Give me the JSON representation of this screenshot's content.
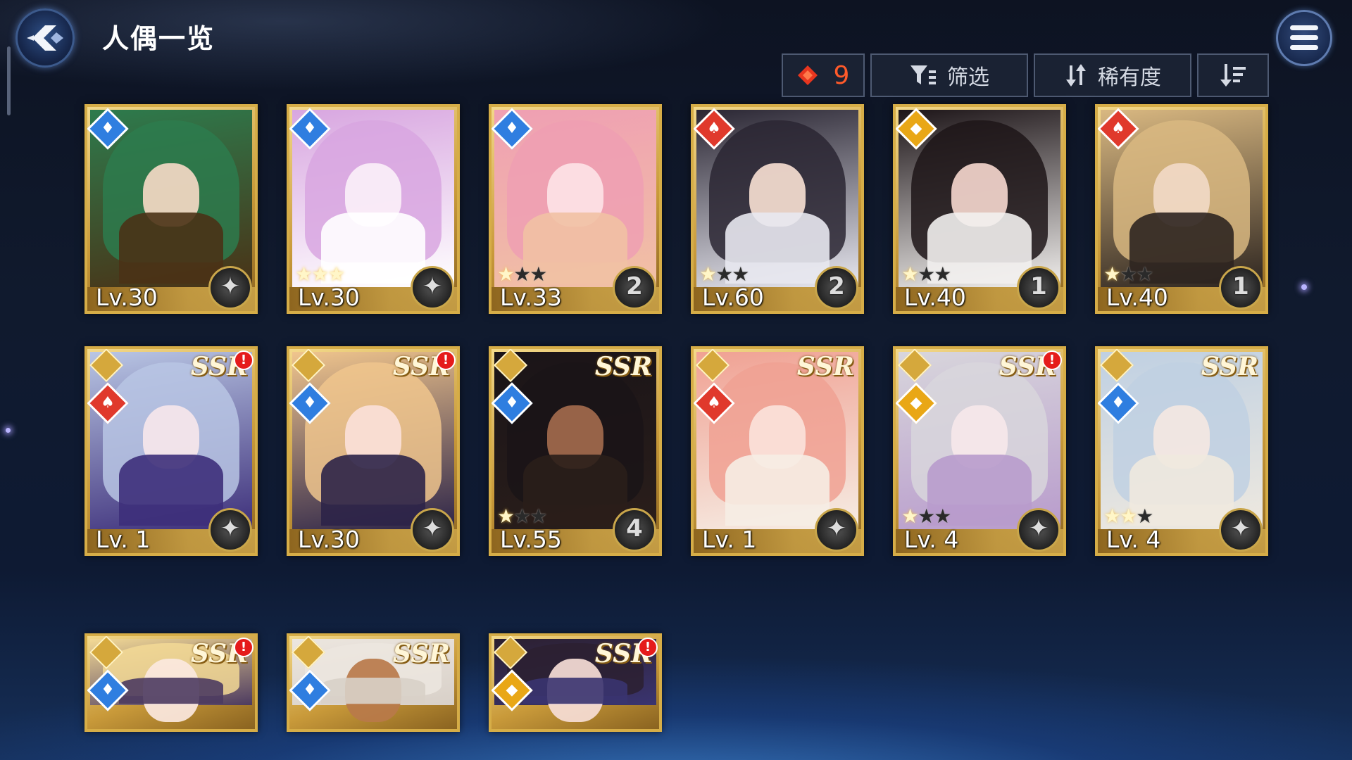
{
  "header": {
    "title": "人偶一览",
    "back_icon": "back-arrow-icon",
    "menu_icon": "hamburger-menu-icon"
  },
  "toolbar": {
    "count": "9",
    "count_icon": "diamond-icon",
    "filter_label": "筛选",
    "filter_icon": "filter-icon",
    "sort_label": "稀有度",
    "sort_icon": "sort-arrows-icon",
    "order_icon": "sort-order-icon"
  },
  "colors": {
    "gold_frame": "#d6ad47",
    "count_red": "#ff5a2a",
    "water": "#2f7ee0",
    "fire": "#e0392c",
    "light": "#e9a716"
  },
  "cards": [
    {
      "level": "Lv.30",
      "element": "water",
      "badge": "",
      "ssr": "",
      "alert": false,
      "stars": 0,
      "max_stars": 0,
      "palette": [
        "#2d7b4d",
        "#f4d9c4",
        "#4a3216"
      ]
    },
    {
      "level": "Lv.30",
      "element": "water",
      "badge": "",
      "ssr": "",
      "alert": false,
      "stars": 3,
      "max_stars": 3,
      "palette": [
        "#d8a6e0",
        "#fbeff8",
        "#ffffff"
      ]
    },
    {
      "level": "Lv.33",
      "element": "water",
      "badge": "2",
      "ssr": "",
      "alert": false,
      "stars": 1,
      "max_stars": 3,
      "palette": [
        "#ef9fb3",
        "#fde2e6",
        "#f1c1a4"
      ]
    },
    {
      "level": "Lv.60",
      "element": "fire",
      "badge": "2",
      "ssr": "",
      "alert": false,
      "stars": 1,
      "max_stars": 3,
      "palette": [
        "#2a2633",
        "#f5ddd0",
        "#e8e8f0"
      ]
    },
    {
      "level": "Lv.40",
      "element": "light",
      "badge": "1",
      "ssr": "",
      "alert": false,
      "stars": 1,
      "max_stars": 3,
      "palette": [
        "#1d1518",
        "#f3d5cc",
        "#f2f0ee"
      ]
    },
    {
      "level": "Lv.40",
      "element": "fire",
      "badge": "1",
      "ssr": "",
      "alert": false,
      "stars": 1,
      "max_stars": 3,
      "palette": [
        "#d9b881",
        "#f1d9c6",
        "#2d2520"
      ]
    },
    {
      "level": "Lv. 1",
      "element": "fire",
      "badge": "",
      "ssr": "SSR",
      "alert": true,
      "stars": 0,
      "max_stars": 0,
      "palette": [
        "#b9c6e4",
        "#f6e6ea",
        "#3d2f7a"
      ]
    },
    {
      "level": "Lv.30",
      "element": "water",
      "badge": "",
      "ssr": "SSR",
      "alert": true,
      "stars": 0,
      "max_stars": 0,
      "palette": [
        "#f0c58d",
        "#fbe0d8",
        "#2c2448"
      ]
    },
    {
      "level": "Lv.55",
      "element": "water",
      "badge": "4",
      "ssr": "SSR",
      "alert": false,
      "stars": 1,
      "max_stars": 3,
      "palette": [
        "#1a1418",
        "#a26a4d",
        "#2a1e1a"
      ]
    },
    {
      "level": "Lv. 1",
      "element": "fire",
      "badge": "",
      "ssr": "SSR",
      "alert": false,
      "stars": 0,
      "max_stars": 0,
      "palette": [
        "#f0a193",
        "#fbe2da",
        "#f6ede4"
      ]
    },
    {
      "level": "Lv. 4",
      "element": "light",
      "badge": "",
      "ssr": "SSR",
      "alert": true,
      "stars": 1,
      "max_stars": 3,
      "palette": [
        "#d8d6dc",
        "#f6e7ea",
        "#b89bcc"
      ]
    },
    {
      "level": "Lv. 4",
      "element": "water",
      "badge": "",
      "ssr": "SSR",
      "alert": false,
      "stars": 2,
      "max_stars": 3,
      "palette": [
        "#bfd0e2",
        "#f4e7e2",
        "#efe9df"
      ]
    },
    {
      "level": "",
      "element": "water",
      "badge": "",
      "ssr": "SSR",
      "alert": true,
      "stars": 0,
      "max_stars": 0,
      "palette": [
        "#f3d995",
        "#fbe8df",
        "#4d3b60"
      ]
    },
    {
      "level": "",
      "element": "water",
      "badge": "",
      "ssr": "SSR",
      "alert": false,
      "stars": 0,
      "max_stars": 0,
      "palette": [
        "#ece6df",
        "#b9794a",
        "#d8d0c8"
      ]
    },
    {
      "level": "",
      "element": "light",
      "badge": "",
      "ssr": "SSR",
      "alert": true,
      "stars": 0,
      "max_stars": 0,
      "palette": [
        "#2c2030",
        "#f6ddd6",
        "#3a3470"
      ]
    }
  ]
}
